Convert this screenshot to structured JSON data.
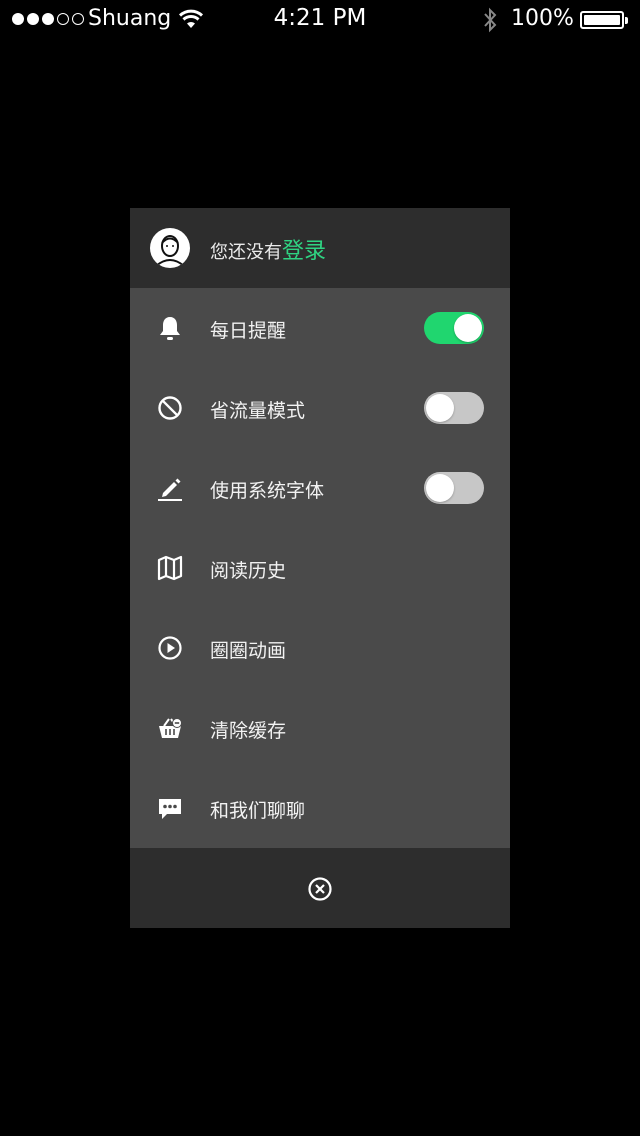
{
  "status_bar": {
    "carrier": "Shuang",
    "time": "4:21 PM",
    "battery": "100%",
    "signal_filled": 3,
    "signal_total": 5
  },
  "header": {
    "prompt": "您还没有",
    "login_link": "登录"
  },
  "menu": {
    "items": [
      {
        "label": "每日提醒",
        "icon": "bell-icon",
        "toggle": true
      },
      {
        "label": "省流量模式",
        "icon": "no-icon",
        "toggle": false
      },
      {
        "label": "使用系统字体",
        "icon": "pencil-icon",
        "toggle": false
      },
      {
        "label": "阅读历史",
        "icon": "map-icon"
      },
      {
        "label": "圈圈动画",
        "icon": "play-circle-icon"
      },
      {
        "label": "清除缓存",
        "icon": "basket-icon"
      },
      {
        "label": "和我们聊聊",
        "icon": "chat-icon"
      }
    ]
  },
  "colors": {
    "accent_green": "#2fd382",
    "toggle_on": "#20d66f",
    "panel_bg": "#4a4a4a",
    "header_bg": "#2d2d2d"
  }
}
